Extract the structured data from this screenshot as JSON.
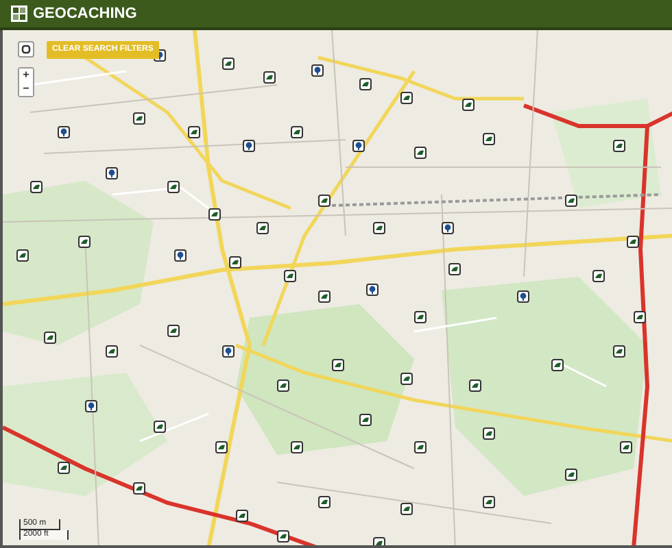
{
  "header": {
    "title": "GEOCACHING"
  },
  "map_controls": {
    "filter_button": "CLEAR SEARCH FILTERS",
    "zoom_in": "+",
    "zoom_out": "−"
  },
  "scale_bar": {
    "metric": "500 m",
    "imperial": "2000 ft"
  }
}
